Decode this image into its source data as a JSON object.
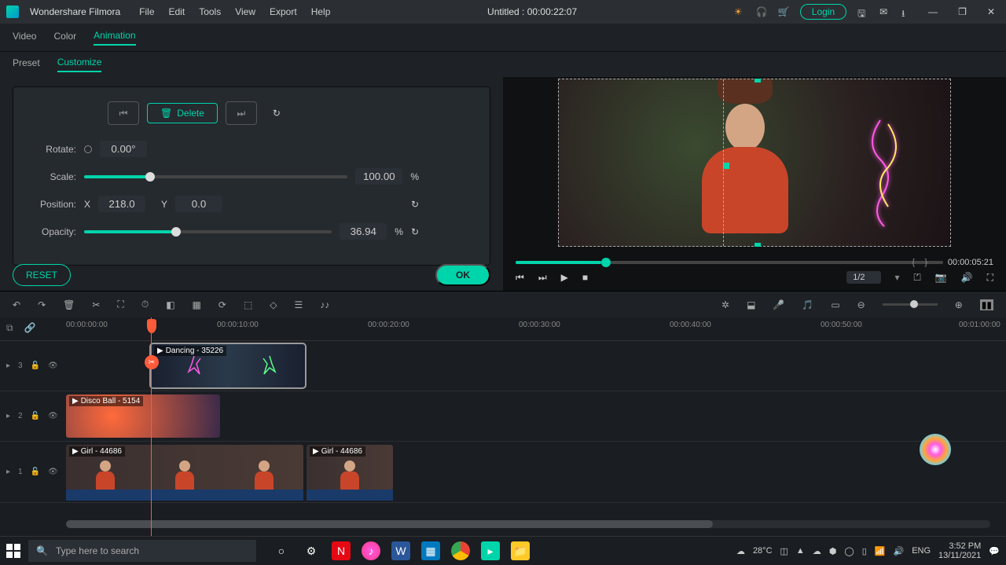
{
  "titlebar": {
    "brand": "Wondershare Filmora",
    "menu": [
      "File",
      "Edit",
      "Tools",
      "View",
      "Export",
      "Help"
    ],
    "title": "Untitled : 00:00:22:07",
    "login": "Login"
  },
  "subtabs": {
    "items": [
      "Video",
      "Color",
      "Animation"
    ],
    "active": 2
  },
  "tabs": {
    "items": [
      "Preset",
      "Customize"
    ],
    "active": 1
  },
  "keyframe": {
    "delete": "Delete",
    "rotate_label": "Rotate:",
    "rotate_value": "0.00°",
    "scale_label": "Scale:",
    "scale_value": "100.00",
    "scale_unit": "%",
    "scale_pct": 25,
    "position_label": "Position:",
    "pos_x_label": "X",
    "pos_x": "218.0",
    "pos_y_label": "Y",
    "pos_y": "0.0",
    "opacity_label": "Opacity:",
    "opacity_value": "36.94",
    "opacity_unit": "%",
    "opacity_pct": 37
  },
  "buttons": {
    "reset": "RESET",
    "ok": "OK"
  },
  "preview": {
    "timecode": "00:00:05:21",
    "zoom": "1/2",
    "scrub_pct": 20
  },
  "ruler": {
    "marks": [
      "00:00:00:00",
      "",
      "00:00:10:00",
      "",
      "00:00:20:00",
      "",
      "00:00:30:00",
      "",
      "00:00:40:00",
      "",
      "00:00:50:00",
      "",
      "00:01:00:00"
    ]
  },
  "tracks": {
    "t3": {
      "label": "3",
      "clip": "Dancing - 35226"
    },
    "t2": {
      "label": "2",
      "clip": "Disco Ball - 5154"
    },
    "t1": {
      "label": "1",
      "clip1": "Girl - 44686",
      "clip2": "Girl - 44686"
    }
  },
  "taskbar": {
    "search": "Type here to search",
    "weather": "28°C",
    "time": "3:52 PM",
    "date": "13/11/2021"
  }
}
